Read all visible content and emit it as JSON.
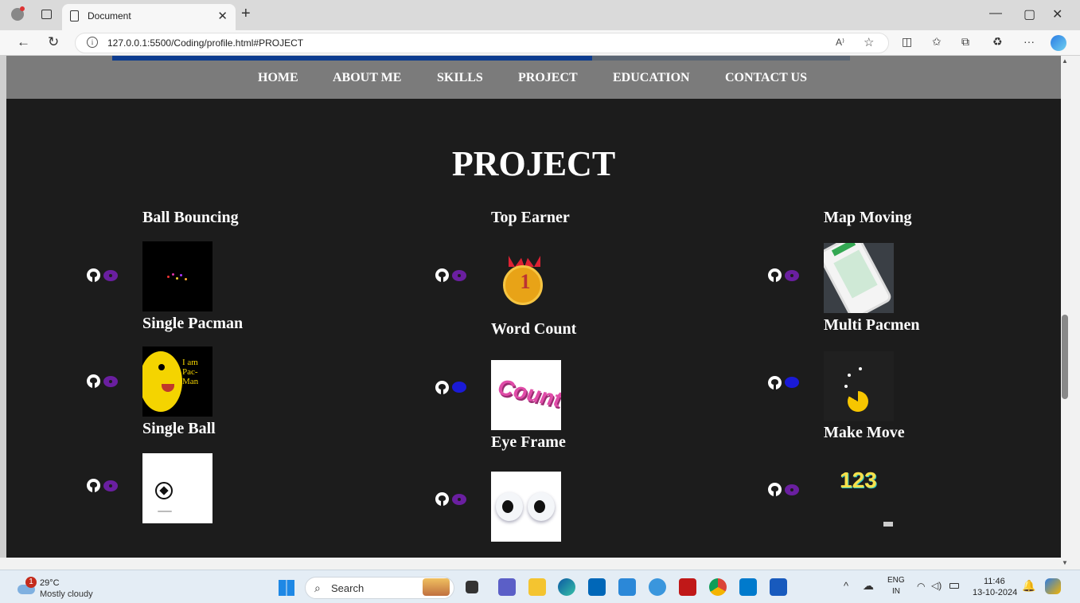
{
  "browser": {
    "tab_title": "Document",
    "url": "127.0.0.1:5500/Coding/profile.html#PROJECT"
  },
  "page": {
    "nav_links": [
      "HOME",
      "ABOUT ME",
      "SKILLS",
      "PROJECT",
      "EDUCATION",
      "CONTACT US"
    ],
    "scroll_progress": 0.65,
    "section_title": "PROJECT",
    "projects": [
      {
        "title": "Ball Bouncing"
      },
      {
        "title": "Top Earner"
      },
      {
        "title": "Map Moving"
      },
      {
        "title": "Single Pacman"
      },
      {
        "title": "Word Count"
      },
      {
        "title": "Multi Pacmen"
      },
      {
        "title": "Single Ball"
      },
      {
        "title": "Eye Frame"
      },
      {
        "title": "Make Move"
      }
    ],
    "pacman_caption": "I am Pac-Man",
    "count_caption": "Count",
    "make_move_digits": "123"
  },
  "taskbar": {
    "weather_temp": "29°C",
    "weather_desc": "Mostly cloudy",
    "weather_badge": "1",
    "search_label": "Search",
    "lang_top": "ENG",
    "lang_bottom": "IN",
    "time": "11:46",
    "date": "13-10-2024"
  },
  "colors": {
    "page_bg": "#1c1c1c",
    "navbar_bg": "#7b7b7b",
    "progress_fill": "#0d3c8f",
    "eye_purple": "#6a1fa0",
    "eye_blue": "#1a1ad6"
  }
}
